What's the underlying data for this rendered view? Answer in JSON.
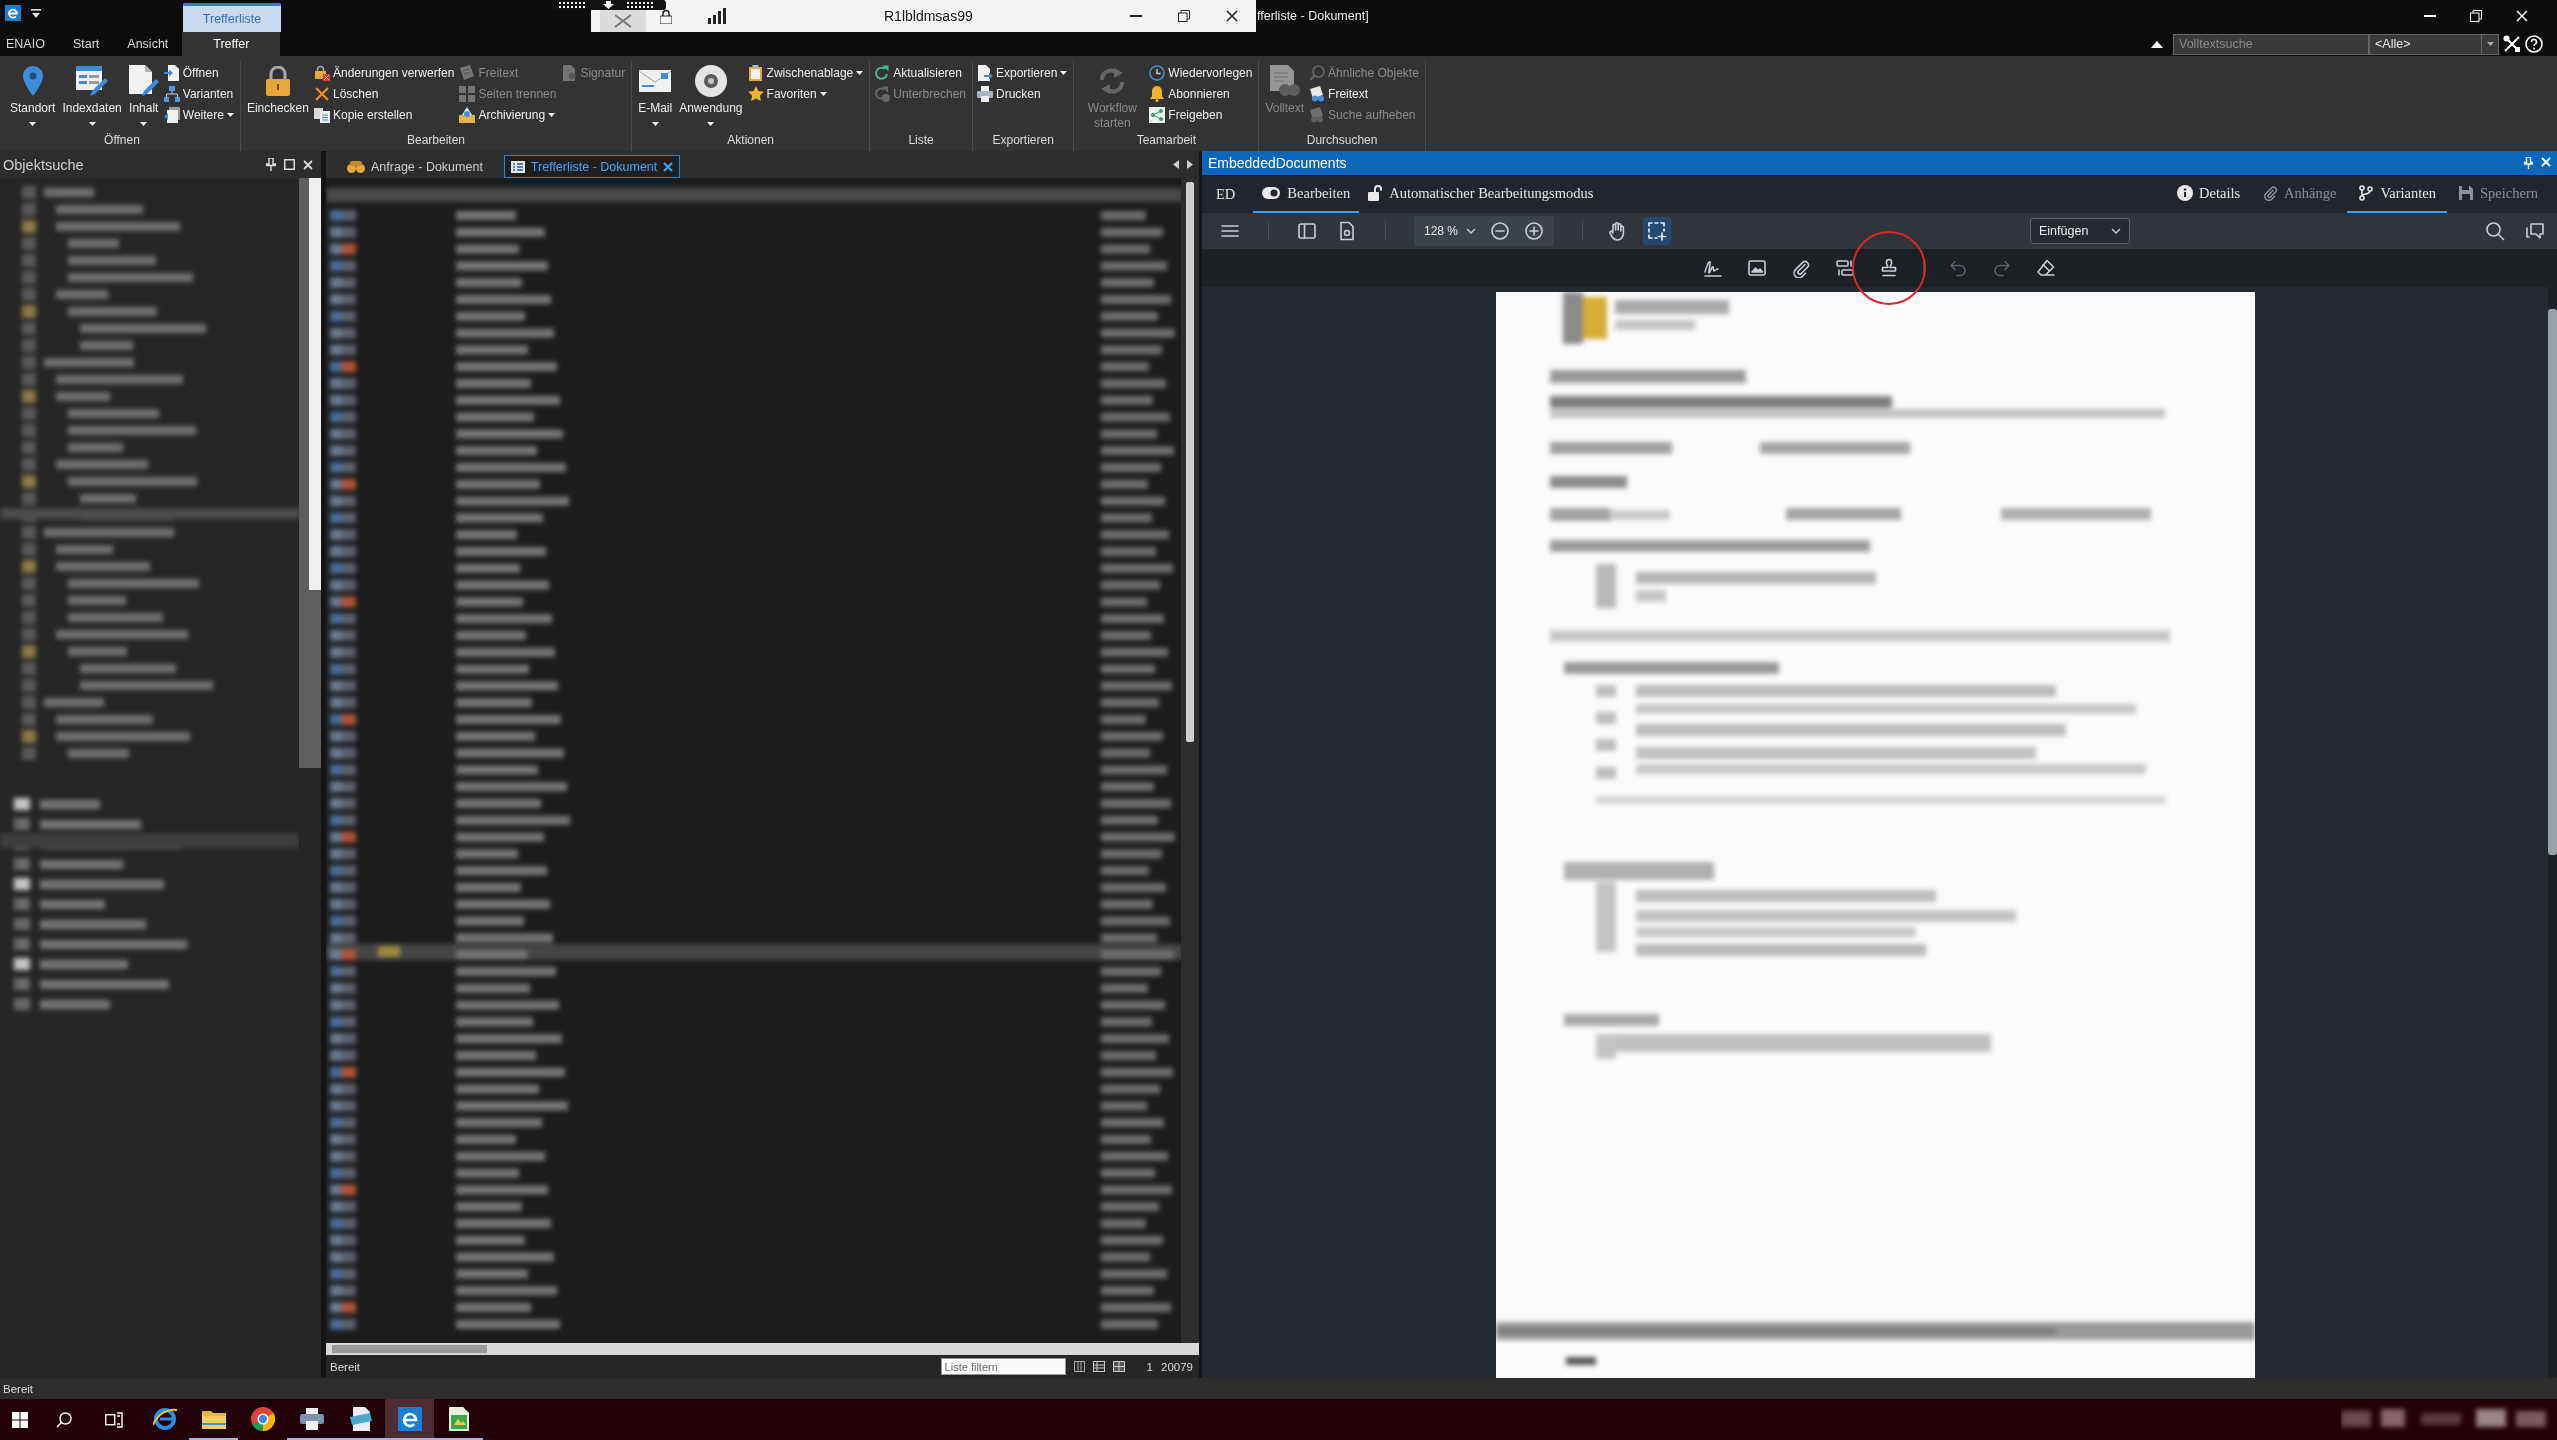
{
  "title_bar": {
    "contextual_tab": "Trefferliste",
    "title": "fferliste - Dokument]",
    "search": {
      "placeholder": "Volltextsuche"
    },
    "scope": "<Alle>"
  },
  "remote_bar": {
    "host": "R1lbldmsas99"
  },
  "ribbon_tabs": [
    {
      "label": "ENAIO",
      "selected": false
    },
    {
      "label": "Start",
      "selected": false
    },
    {
      "label": "Ansicht",
      "selected": false
    },
    {
      "label": "Treffer",
      "selected": true
    }
  ],
  "ribbon_groups": [
    {
      "title": "Öffnen",
      "large": [
        {
          "label": "Standort",
          "disabled": false,
          "dropdown": true
        },
        {
          "label": "Indexdaten",
          "disabled": false,
          "dropdown": true
        },
        {
          "label": "Inhalt",
          "disabled": false,
          "dropdown": true
        }
      ],
      "columns": [
        [
          {
            "label": "Öffnen",
            "disabled": false,
            "dropdown": false
          },
          {
            "label": "Varianten",
            "disabled": false,
            "dropdown": false
          },
          {
            "label": "Weitere",
            "disabled": false,
            "dropdown": true
          }
        ]
      ]
    },
    {
      "title": "Bearbeiten",
      "large": [
        {
          "label": "Einchecken",
          "disabled": false,
          "dropdown": false
        }
      ],
      "columns": [
        [
          {
            "label": "Änderungen verwerfen",
            "disabled": false,
            "dropdown": false
          },
          {
            "label": "Löschen",
            "disabled": false,
            "dropdown": false
          },
          {
            "label": "Kopie erstellen",
            "disabled": false,
            "dropdown": false
          }
        ],
        [
          {
            "label": "Freitext",
            "disabled": true,
            "dropdown": false
          },
          {
            "label": "Seiten trennen",
            "disabled": true,
            "dropdown": false
          },
          {
            "label": "Archivierung",
            "disabled": false,
            "dropdown": true
          }
        ],
        [
          {
            "label": "Signatur",
            "disabled": true,
            "dropdown": false
          }
        ]
      ]
    },
    {
      "title": "Aktionen",
      "large": [
        {
          "label": "E-Mail",
          "disabled": false,
          "dropdown": true
        },
        {
          "label": "Anwendung",
          "disabled": false,
          "dropdown": true
        }
      ],
      "columns": [
        [
          {
            "label": "Zwischenablage",
            "disabled": false,
            "dropdown": true
          },
          {
            "label": "Favoriten",
            "disabled": false,
            "dropdown": true
          }
        ]
      ]
    },
    {
      "title": "Liste",
      "columns": [
        [
          {
            "label": "Aktualisieren",
            "disabled": false,
            "dropdown": false
          },
          {
            "label": "Unterbrechen",
            "disabled": true,
            "dropdown": false
          }
        ]
      ]
    },
    {
      "title": "Exportieren",
      "columns": [
        [
          {
            "label": "Exportieren",
            "disabled": false,
            "dropdown": true
          },
          {
            "label": "Drucken",
            "disabled": false,
            "dropdown": false
          }
        ]
      ]
    },
    {
      "title": "Teamarbeit",
      "large": [
        {
          "label": "Workflow starten",
          "disabled": true,
          "dropdown": false
        }
      ],
      "columns": [
        [
          {
            "label": "Wiedervorlegen",
            "disabled": false,
            "dropdown": false
          },
          {
            "label": "Abonnieren",
            "disabled": false,
            "dropdown": false
          },
          {
            "label": "Freigeben",
            "disabled": false,
            "dropdown": false
          }
        ]
      ]
    },
    {
      "title": "Durchsuchen",
      "large": [
        {
          "label": "Volltext",
          "disabled": true,
          "dropdown": false
        }
      ],
      "columns": [
        [
          {
            "label": "Ähnliche Objekte",
            "disabled": true,
            "dropdown": false
          },
          {
            "label": "Freitext",
            "disabled": false,
            "dropdown": false
          },
          {
            "label": "Suche aufheben",
            "disabled": true,
            "dropdown": false
          }
        ]
      ]
    }
  ],
  "object_search": {
    "title": "Objektsuche"
  },
  "document_tabs": [
    {
      "label": "Anfrage - Dokument",
      "selected": false
    },
    {
      "label": "Trefferliste - Dokument",
      "selected": true
    }
  ],
  "result_list": {
    "status": "Bereit",
    "filter": {
      "placeholder": "Liste filtern"
    },
    "page": "1",
    "count": "20079"
  },
  "viewer": {
    "title": "EmbeddedDocuments",
    "badge": "ED",
    "mode_tabs": [
      {
        "label": "Bearbeiten",
        "selected": true
      },
      {
        "label": "Automatischer Bearbeitungsmodus",
        "selected": false
      }
    ],
    "actions": [
      {
        "label": "Details",
        "disabled": false,
        "selected": false
      },
      {
        "label": "Anhänge",
        "disabled": true,
        "selected": false
      },
      {
        "label": "Varianten",
        "disabled": false,
        "selected": true
      },
      {
        "label": "Speichern",
        "disabled": true,
        "selected": false
      }
    ],
    "zoom": "128 %",
    "pan_tools": [
      {
        "selected": false
      },
      {
        "selected": true
      }
    ],
    "insert_mode": "Einfügen",
    "annotation_tools": [
      {
        "disabled": false,
        "circled": false
      },
      {
        "disabled": false,
        "circled": false
      },
      {
        "disabled": false,
        "circled": false
      },
      {
        "disabled": false,
        "circled": false
      },
      {
        "disabled": false,
        "circled": true
      },
      {
        "disabled": true,
        "circled": false
      },
      {
        "disabled": true,
        "circled": false
      },
      {
        "disabled": false,
        "circled": false
      }
    ]
  },
  "status_bar": {
    "text": "Bereit"
  },
  "taskbar": {
    "apps": [
      {
        "running": false,
        "selected": false
      },
      {
        "running": true,
        "selected": false
      },
      {
        "running": false,
        "selected": false
      },
      {
        "running": true,
        "selected": false
      },
      {
        "running": true,
        "selected": false
      },
      {
        "running": true,
        "selected": true
      },
      {
        "running": true,
        "selected": false
      }
    ]
  }
}
